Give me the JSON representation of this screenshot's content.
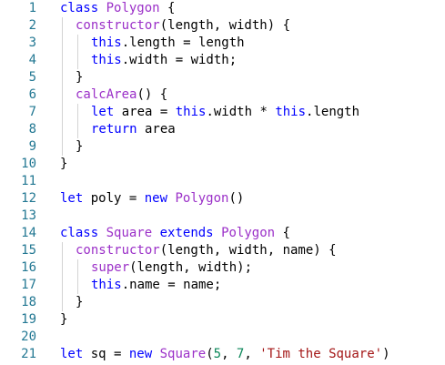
{
  "colors": {
    "keyword": "#0000ff",
    "class_name": "#9b30c8",
    "number": "#098658",
    "string": "#a31515",
    "line_number": "#237893",
    "text": "#000000",
    "indent_guide": "#d3d3d3"
  },
  "lines": [
    {
      "n": "1",
      "indent": 0,
      "tokens": [
        {
          "t": "class",
          "c": "kw"
        },
        {
          "t": " "
        },
        {
          "t": "Polygon",
          "c": "cls"
        },
        {
          "t": " {"
        }
      ]
    },
    {
      "n": "2",
      "indent": 1,
      "tokens": [
        {
          "t": "constructor",
          "c": "cls"
        },
        {
          "t": "(length, width) {"
        }
      ]
    },
    {
      "n": "3",
      "indent": 2,
      "tokens": [
        {
          "t": "this",
          "c": "kw"
        },
        {
          "t": ".length = length"
        }
      ]
    },
    {
      "n": "4",
      "indent": 2,
      "tokens": [
        {
          "t": "this",
          "c": "kw"
        },
        {
          "t": ".width = width;"
        }
      ]
    },
    {
      "n": "5",
      "indent": 1,
      "tokens": [
        {
          "t": "}"
        }
      ]
    },
    {
      "n": "6",
      "indent": 1,
      "tokens": [
        {
          "t": "calcArea",
          "c": "cls"
        },
        {
          "t": "() {"
        }
      ]
    },
    {
      "n": "7",
      "indent": 2,
      "tokens": [
        {
          "t": "let",
          "c": "kw"
        },
        {
          "t": " area = "
        },
        {
          "t": "this",
          "c": "kw"
        },
        {
          "t": ".width * "
        },
        {
          "t": "this",
          "c": "kw"
        },
        {
          "t": ".length"
        }
      ]
    },
    {
      "n": "8",
      "indent": 2,
      "tokens": [
        {
          "t": "return",
          "c": "kw"
        },
        {
          "t": " area"
        }
      ]
    },
    {
      "n": "9",
      "indent": 1,
      "tokens": [
        {
          "t": "}"
        }
      ]
    },
    {
      "n": "10",
      "indent": 0,
      "tokens": [
        {
          "t": "}"
        }
      ]
    },
    {
      "n": "11",
      "indent": 0,
      "tokens": []
    },
    {
      "n": "12",
      "indent": 0,
      "tokens": [
        {
          "t": "let",
          "c": "kw"
        },
        {
          "t": " poly = "
        },
        {
          "t": "new",
          "c": "kw"
        },
        {
          "t": " "
        },
        {
          "t": "Polygon",
          "c": "cls"
        },
        {
          "t": "()"
        }
      ]
    },
    {
      "n": "13",
      "indent": 0,
      "tokens": []
    },
    {
      "n": "14",
      "indent": 0,
      "tokens": [
        {
          "t": "class",
          "c": "kw"
        },
        {
          "t": " "
        },
        {
          "t": "Square",
          "c": "cls"
        },
        {
          "t": " "
        },
        {
          "t": "extends",
          "c": "kw"
        },
        {
          "t": " "
        },
        {
          "t": "Polygon",
          "c": "cls"
        },
        {
          "t": " {"
        }
      ]
    },
    {
      "n": "15",
      "indent": 1,
      "tokens": [
        {
          "t": "constructor",
          "c": "cls"
        },
        {
          "t": "(length, width, name) {"
        }
      ]
    },
    {
      "n": "16",
      "indent": 2,
      "tokens": [
        {
          "t": "super",
          "c": "cls"
        },
        {
          "t": "(length, width);"
        }
      ]
    },
    {
      "n": "17",
      "indent": 2,
      "tokens": [
        {
          "t": "this",
          "c": "kw"
        },
        {
          "t": ".name = name;"
        }
      ]
    },
    {
      "n": "18",
      "indent": 1,
      "tokens": [
        {
          "t": "}"
        }
      ]
    },
    {
      "n": "19",
      "indent": 0,
      "tokens": [
        {
          "t": "}"
        }
      ]
    },
    {
      "n": "20",
      "indent": 0,
      "tokens": []
    },
    {
      "n": "21",
      "indent": 0,
      "tokens": [
        {
          "t": "let",
          "c": "kw"
        },
        {
          "t": " sq = "
        },
        {
          "t": "new",
          "c": "kw"
        },
        {
          "t": " "
        },
        {
          "t": "Square",
          "c": "cls"
        },
        {
          "t": "("
        },
        {
          "t": "5",
          "c": "num"
        },
        {
          "t": ", "
        },
        {
          "t": "7",
          "c": "num"
        },
        {
          "t": ", "
        },
        {
          "t": "'Tim the Square'",
          "c": "str"
        },
        {
          "t": ")"
        }
      ]
    }
  ]
}
